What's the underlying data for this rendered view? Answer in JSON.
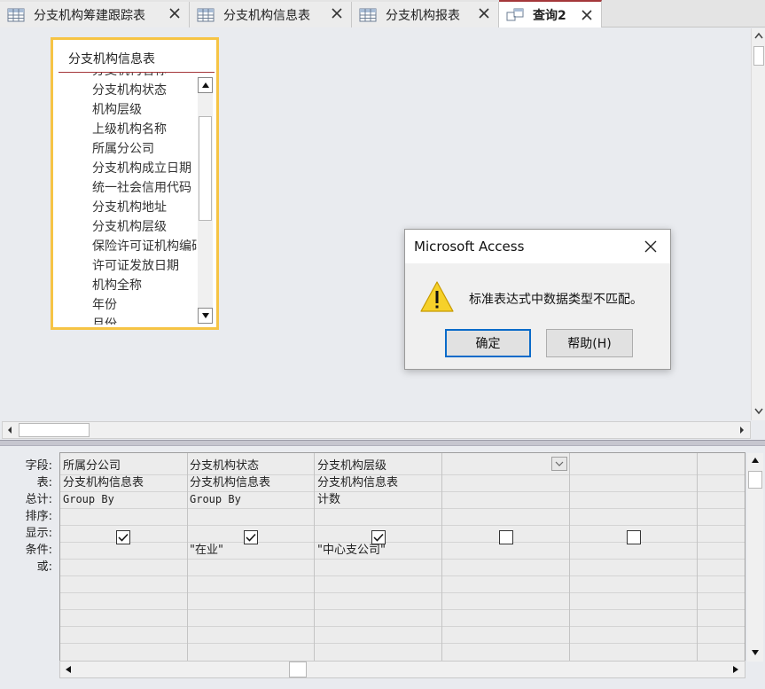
{
  "tabs": [
    {
      "label": "分支机构筹建跟踪表",
      "icon": "table-icon",
      "active": false
    },
    {
      "label": "分支机构信息表",
      "icon": "table-icon",
      "active": false
    },
    {
      "label": "分支机构报表",
      "icon": "table-icon",
      "active": false
    },
    {
      "label": "查询2",
      "icon": "query-icon",
      "active": true
    }
  ],
  "field_list": {
    "title": "分支机构信息表",
    "partial_top": "分支机构名称",
    "items": [
      "分支机构状态",
      "机构层级",
      "上级机构名称",
      "所属分公司",
      "分支机构成立日期",
      "统一社会信用代码",
      "分支机构地址",
      "分支机构层级",
      "保险许可证机构编码",
      "许可证发放日期",
      "机构全称",
      "年份",
      "月份"
    ]
  },
  "dialog": {
    "title": "Microsoft Access",
    "message": "标准表达式中数据类型不匹配。",
    "ok_label": "确定",
    "help_label": "帮助(H)"
  },
  "grid": {
    "row_labels": [
      "字段:",
      "表:",
      "总计:",
      "排序:",
      "显示:",
      "条件:",
      "或:"
    ],
    "columns": [
      {
        "field": "所属分公司",
        "table": "分支机构信息表",
        "total": "Group By",
        "sort": "",
        "show": true,
        "criteria": ""
      },
      {
        "field": "分支机构状态",
        "table": "分支机构信息表",
        "total": "Group By",
        "sort": "",
        "show": true,
        "criteria": "\"在业\""
      },
      {
        "field": "分支机构层级",
        "table": "分支机构信息表",
        "total": "计数",
        "sort": "",
        "show": true,
        "criteria": "\"中心支公司\""
      },
      {
        "field": "",
        "table": "",
        "total": "",
        "sort": "",
        "show": false,
        "criteria": ""
      },
      {
        "field": "",
        "table": "",
        "total": "",
        "sort": "",
        "show": false,
        "criteria": ""
      }
    ]
  },
  "colors": {
    "active_tab_accent": "#a4373a",
    "field_box_border": "#f6c445",
    "ok_button_border": "#0a6bc9",
    "warning_yellow": "#f6d12a"
  }
}
